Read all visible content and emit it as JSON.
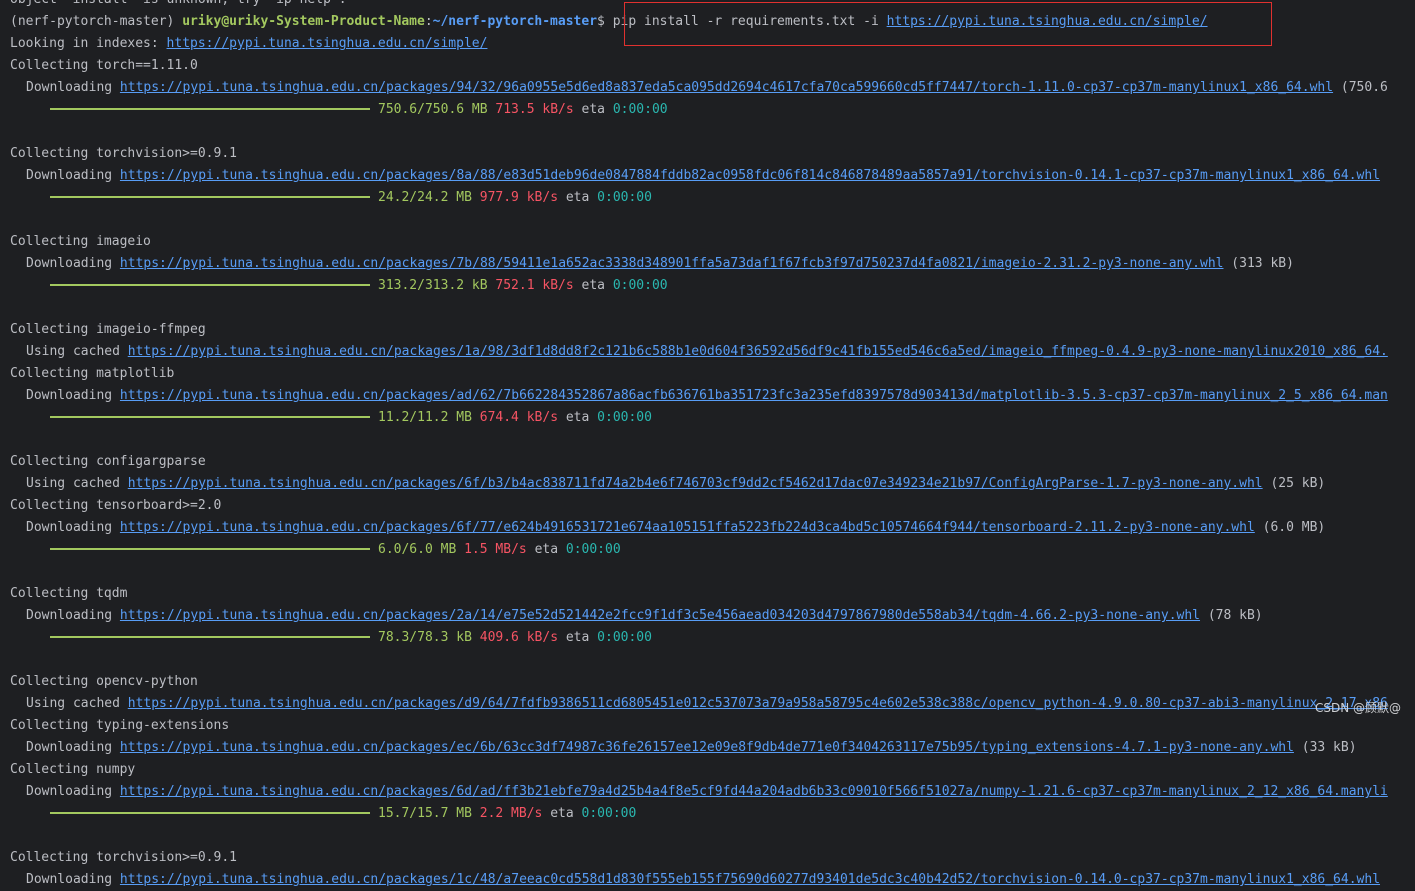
{
  "terminal": {
    "lines": [
      {
        "kind": "text",
        "text": "object 'install' is unknown, try 'ip help'."
      },
      {
        "kind": "prompt",
        "env": "(nerf-pytorch-master) ",
        "user": "uriky@uriky-System-Product-Name",
        "sep": ":",
        "path": "~/nerf-pytorch-master",
        "dollar": "$ ",
        "cmd": "pip install -r requirements.txt -i ",
        "url": "https://pypi.tuna.tsinghua.edu.cn/simple/"
      },
      {
        "kind": "text",
        "text": "Looking in indexes: ",
        "url": "https://pypi.tuna.tsinghua.edu.cn/simple/"
      },
      {
        "kind": "text",
        "text": "Collecting torch==1.11.0"
      },
      {
        "kind": "download",
        "verb": "Downloading ",
        "url": "https://pypi.tuna.tsinghua.edu.cn/packages/94/32/96a0955e5d6ed8a837eda5ca095dd2694c4617cfa70ca599660cd5ff7447/torch-1.11.0-cp37-cp37m-manylinux1_x86_64.whl",
        "size": " (750.6"
      },
      {
        "kind": "progress",
        "done": "750.6/750.6 MB",
        "rate": "713.5 kB/s",
        "eta_label": "eta",
        "eta": "0:00:00"
      },
      {
        "kind": "blank"
      },
      {
        "kind": "text",
        "text": "Collecting torchvision>=0.9.1"
      },
      {
        "kind": "download",
        "verb": "Downloading ",
        "url": "https://pypi.tuna.tsinghua.edu.cn/packages/8a/88/e83d51deb96de0847884fddb82ac0958fdc06f814c846878489aa5857a91/torchvision-0.14.1-cp37-cp37m-manylinux1_x86_64.whl",
        "size": ""
      },
      {
        "kind": "progress",
        "done": "24.2/24.2 MB",
        "rate": "977.9 kB/s",
        "eta_label": "eta",
        "eta": "0:00:00"
      },
      {
        "kind": "blank"
      },
      {
        "kind": "text",
        "text": "Collecting imageio"
      },
      {
        "kind": "download",
        "verb": "Downloading ",
        "url": "https://pypi.tuna.tsinghua.edu.cn/packages/7b/88/59411e1a652ac3338d348901ffa5a73daf1f67fcb3f97d750237d4fa0821/imageio-2.31.2-py3-none-any.whl",
        "size": " (313 kB)"
      },
      {
        "kind": "progress",
        "done": "313.2/313.2 kB",
        "rate": "752.1 kB/s",
        "eta_label": "eta",
        "eta": "0:00:00"
      },
      {
        "kind": "blank"
      },
      {
        "kind": "text",
        "text": "Collecting imageio-ffmpeg"
      },
      {
        "kind": "download",
        "verb": "Using cached ",
        "url": "https://pypi.tuna.tsinghua.edu.cn/packages/1a/98/3df1d8dd8f2c121b6c588b1e0d604f36592d56df9c41fb155ed546c6a5ed/imageio_ffmpeg-0.4.9-py3-none-manylinux2010_x86_64.",
        "size": ""
      },
      {
        "kind": "text",
        "text": "Collecting matplotlib"
      },
      {
        "kind": "download",
        "verb": "Downloading ",
        "url": "https://pypi.tuna.tsinghua.edu.cn/packages/ad/62/7b662284352867a86acfb636761ba351723fc3a235efd8397578d903413d/matplotlib-3.5.3-cp37-cp37m-manylinux_2_5_x86_64.man",
        "size": ""
      },
      {
        "kind": "progress",
        "done": "11.2/11.2 MB",
        "rate": "674.4 kB/s",
        "eta_label": "eta",
        "eta": "0:00:00"
      },
      {
        "kind": "blank"
      },
      {
        "kind": "text",
        "text": "Collecting configargparse"
      },
      {
        "kind": "download",
        "verb": "Using cached ",
        "url": "https://pypi.tuna.tsinghua.edu.cn/packages/6f/b3/b4ac838711fd74a2b4e6f746703cf9dd2cf5462d17dac07e349234e21b97/ConfigArgParse-1.7-py3-none-any.whl",
        "size": " (25 kB)"
      },
      {
        "kind": "text",
        "text": "Collecting tensorboard>=2.0"
      },
      {
        "kind": "download",
        "verb": "Downloading ",
        "url": "https://pypi.tuna.tsinghua.edu.cn/packages/6f/77/e624b4916531721e674aa105151ffa5223fb224d3ca4bd5c10574664f944/tensorboard-2.11.2-py3-none-any.whl",
        "size": " (6.0 MB)"
      },
      {
        "kind": "progress",
        "done": "6.0/6.0 MB",
        "rate": "1.5 MB/s",
        "eta_label": "eta",
        "eta": "0:00:00"
      },
      {
        "kind": "blank"
      },
      {
        "kind": "text",
        "text": "Collecting tqdm"
      },
      {
        "kind": "download",
        "verb": "Downloading ",
        "url": "https://pypi.tuna.tsinghua.edu.cn/packages/2a/14/e75e52d521442e2fcc9f1df3c5e456aead034203d4797867980de558ab34/tqdm-4.66.2-py3-none-any.whl",
        "size": " (78 kB)"
      },
      {
        "kind": "progress",
        "done": "78.3/78.3 kB",
        "rate": "409.6 kB/s",
        "eta_label": "eta",
        "eta": "0:00:00"
      },
      {
        "kind": "blank"
      },
      {
        "kind": "text",
        "text": "Collecting opencv-python"
      },
      {
        "kind": "download",
        "verb": "Using cached ",
        "url": "https://pypi.tuna.tsinghua.edu.cn/packages/d9/64/7fdfb9386511cd6805451e012c537073a79a958a58795c4e602e538c388c/opencv_python-4.9.0.80-cp37-abi3-manylinux_2_17_x86",
        "size": ""
      },
      {
        "kind": "text",
        "text": "Collecting typing-extensions"
      },
      {
        "kind": "download",
        "verb": "Downloading ",
        "url": "https://pypi.tuna.tsinghua.edu.cn/packages/ec/6b/63cc3df74987c36fe26157ee12e09e8f9db4de771e0f3404263117e75b95/typing_extensions-4.7.1-py3-none-any.whl",
        "size": " (33 kB)"
      },
      {
        "kind": "text",
        "text": "Collecting numpy"
      },
      {
        "kind": "download",
        "verb": "Downloading ",
        "url": "https://pypi.tuna.tsinghua.edu.cn/packages/6d/ad/ff3b21ebfe79a4d25b4a4f8e5cf9fd44a204adb6b33c09010f566f51027a/numpy-1.21.6-cp37-cp37m-manylinux_2_12_x86_64.manyli",
        "size": ""
      },
      {
        "kind": "progress",
        "done": "15.7/15.7 MB",
        "rate": "2.2 MB/s",
        "eta_label": "eta",
        "eta": "0:00:00"
      },
      {
        "kind": "blank"
      },
      {
        "kind": "text",
        "text": "Collecting torchvision>=0.9.1"
      },
      {
        "kind": "download",
        "verb": "Downloading ",
        "url": "https://pypi.tuna.tsinghua.edu.cn/packages/1c/48/a7eeac0cd558d1d830f555eb155f75690d60277d93401de5dc3c40b42d52/torchvision-0.14.0-cp37-cp37m-manylinux1_x86_64.whl",
        "size": ""
      }
    ]
  },
  "watermark": "CSDN @顾默@",
  "colors": {
    "background": "#1e1f22",
    "link": "#589df6",
    "progress": "#a3c85f",
    "rate": "#f75464",
    "eta": "#2ab7b0",
    "highlight_box": "#e0312f"
  }
}
